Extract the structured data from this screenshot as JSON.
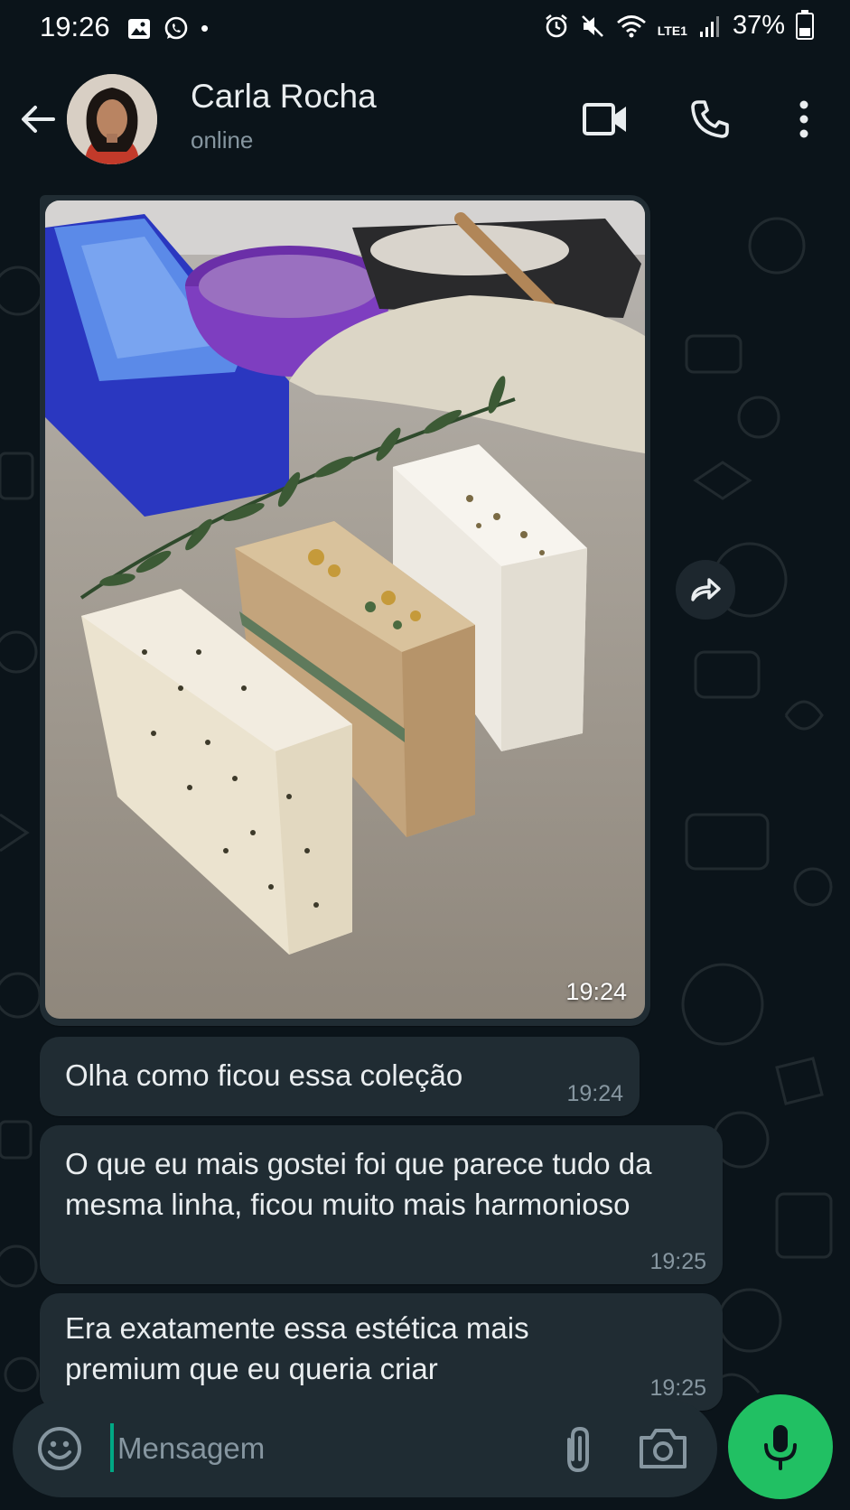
{
  "status_bar": {
    "time": "19:26",
    "battery": "37%",
    "network_label": "LTE1",
    "dot": "•"
  },
  "header": {
    "contact_name": "Carla Rocha",
    "contact_status": "online"
  },
  "messages": [
    {
      "type": "image",
      "time": "19:24"
    },
    {
      "type": "text",
      "text": "Olha como ficou essa coleção",
      "time": "19:24"
    },
    {
      "type": "text",
      "text": "O que eu mais gostei foi que parece tudo da mesma linha, ficou muito mais harmonioso",
      "time": "19:25"
    },
    {
      "type": "text",
      "text": "Era exatamente essa estética mais premium que eu queria criar",
      "time": "19:25"
    }
  ],
  "composer": {
    "placeholder": "Mensagem"
  },
  "colors": {
    "background": "#0b141a",
    "bubble": "#202c33",
    "accent_green": "#21c063",
    "secondary_text": "#8696a0"
  },
  "icons": [
    "arrow-back-icon",
    "video-call-icon",
    "phone-icon",
    "more-vert-icon",
    "forward-icon",
    "emoji-icon",
    "attach-icon",
    "camera-icon",
    "mic-icon",
    "gallery-icon",
    "whatsapp-icon",
    "alarm-icon",
    "mute-icon",
    "wifi-icon",
    "signal-icon",
    "battery-icon"
  ]
}
